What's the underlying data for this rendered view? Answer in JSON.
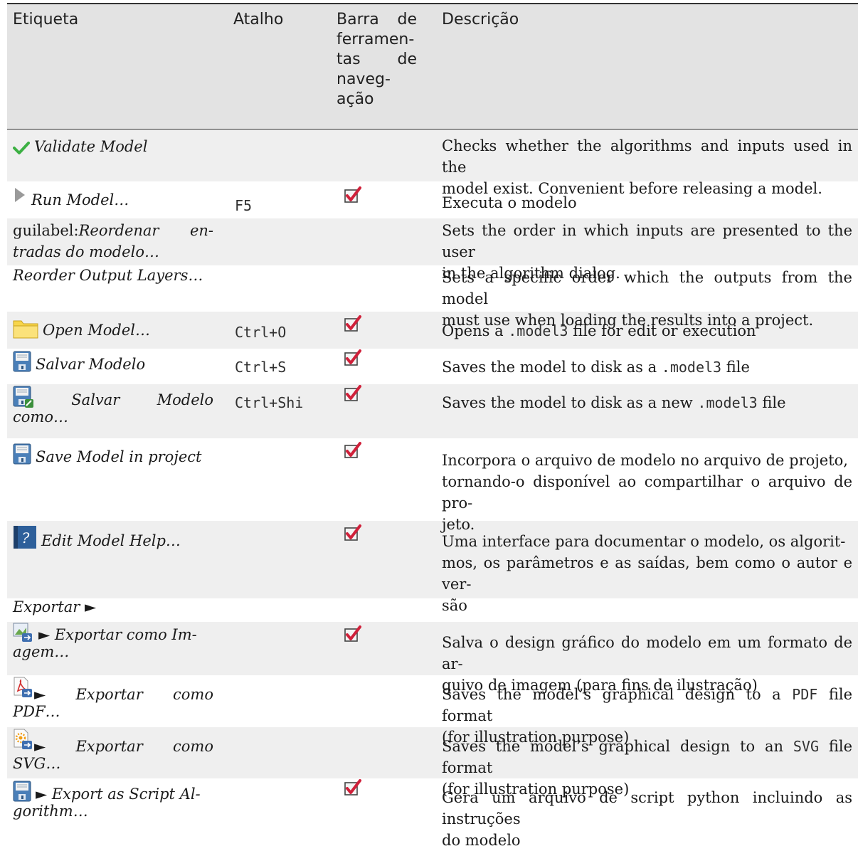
{
  "headers": {
    "label": "Etiqueta",
    "shortcut": "Atalho",
    "toolbar_l1a": "Barra",
    "toolbar_l1b": "de",
    "toolbar_l2": "ferramen-",
    "toolbar_l3a": "tas",
    "toolbar_l3b": "de",
    "toolbar_l4": "naveg-",
    "toolbar_l5": "ação",
    "description": "Descrição"
  },
  "rows": [
    {
      "label": "Validate Model",
      "shortcut": "",
      "desc_l1": "Checks whether the algorithms and inputs used in the",
      "desc_l2": "model exist. Convenient before releasing a model."
    },
    {
      "label": "Run Model…",
      "shortcut": "F5",
      "desc_l1": "Executa o modelo"
    },
    {
      "label_l1a": "guilabel:",
      "label_l1b": "Reordenar",
      "label_l1c": "en-",
      "label_l2": "tradas do modelo…",
      "desc_l1": "Sets the order in which inputs are presented to the user",
      "desc_l2": "in the algorithm dialog."
    },
    {
      "label": "Reorder Output Layers…",
      "desc_l1": "Sets a specific order which the outputs from the model",
      "desc_l2": "must use when loading the results into a project."
    },
    {
      "label": "Open Model…",
      "shortcut": "Ctrl+O",
      "desc_a": "Opens a ",
      "desc_code": ".model3",
      "desc_b": " file for edit or execution"
    },
    {
      "label": "Salvar Modelo",
      "shortcut": "Ctrl+S",
      "desc_a": "Saves the model to disk as a ",
      "desc_code": ".model3",
      "desc_b": " file"
    },
    {
      "label_w1": "Salvar",
      "label_w2": "Modelo",
      "label_l2": "como…",
      "shortcut": "Ctrl+Shi",
      "desc_a": "Saves the model to disk as a new ",
      "desc_code": ".model3",
      "desc_b": " file"
    },
    {
      "label": "Save Model in project",
      "desc_l1": "Incorpora o arquivo de modelo no arquivo de projeto,",
      "desc_l2": "tornando-o disponível ao compartilhar o arquivo de pro-",
      "desc_l3": "jeto."
    },
    {
      "label": "Edit Model Help…",
      "desc_l1": "Uma interface para documentar o modelo, os algorit-",
      "desc_l2": "mos, os parâmetros e as saídas, bem como o autor e ver-",
      "desc_l3": "são"
    },
    {
      "label": "Exportar ►"
    },
    {
      "label_l1": "► Exportar como Im-",
      "label_l2": "agem…",
      "desc_l1": "Salva o design gráfico do modelo em um formato de ar-",
      "desc_l2": "quivo de imagem (para fins de ilustração)"
    },
    {
      "label_w1": "Exportar",
      "label_w2": "como",
      "label_l2": "PDF…",
      "desc_a": "Saves the model’s graphical design to a ",
      "desc_code": "PDF",
      "desc_b": " file format",
      "desc_l2": "(for illustration purpose)"
    },
    {
      "label_w1": "Exportar",
      "label_w2": "como",
      "label_l2": "SVG…",
      "desc_a": "Saves the model’s graphical design to an ",
      "desc_code": "SVG",
      "desc_b": " file format",
      "desc_l2": "(for illustration purpose)"
    },
    {
      "label_l1": "► Export as Script Al-",
      "label_l2": "gorithm…",
      "desc_l1": "Gera um arquivo de script python incluindo as instruções",
      "desc_l2": "do modelo"
    }
  ],
  "colors": {
    "header_bg": "#e3e3e3",
    "row_shade": "#efefef",
    "check_red": "#d0203a",
    "validate_green": "#3cb043"
  }
}
